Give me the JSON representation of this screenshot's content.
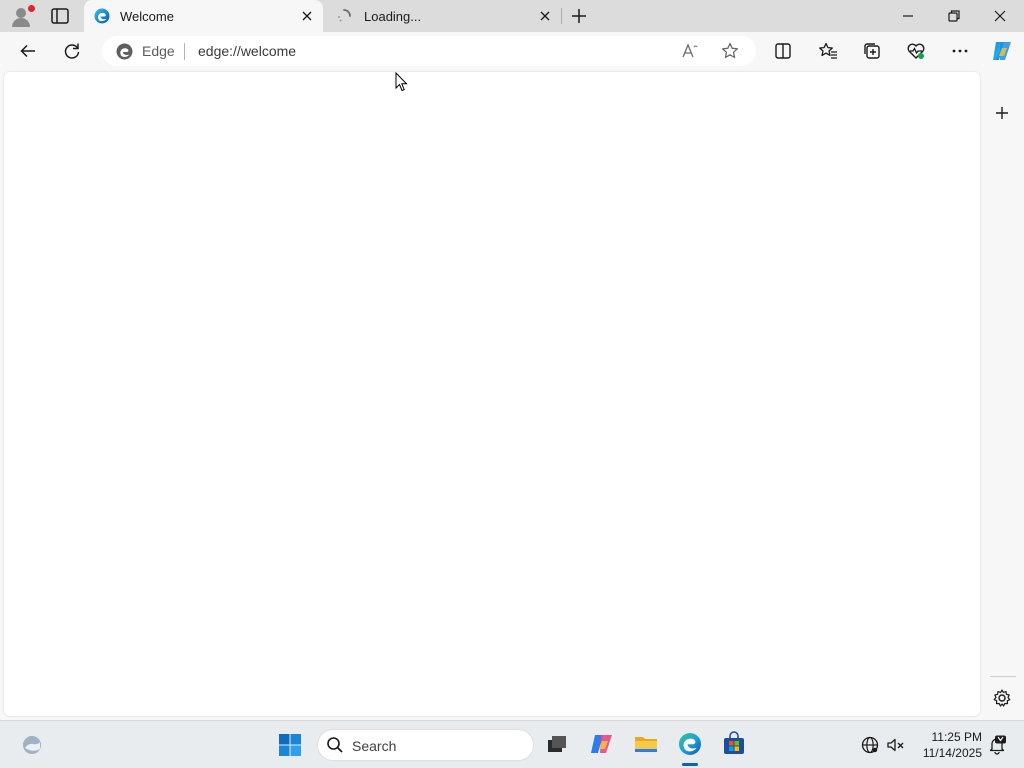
{
  "browser": {
    "tabs": [
      {
        "title": "Welcome",
        "icon": "edge-icon",
        "active": true
      },
      {
        "title": "Loading...",
        "icon": "loading-spinner-icon",
        "active": false
      }
    ],
    "omnibox": {
      "chip": "Edge",
      "url": "edge://welcome"
    }
  },
  "taskbar": {
    "search_placeholder": "Search",
    "clock": {
      "time": "11:25 PM",
      "date": "11/14/2025"
    }
  },
  "colors": {
    "accent": "#0067c0",
    "tabstrip": "#dcdcdc",
    "toolbar": "#f7f7f7"
  }
}
